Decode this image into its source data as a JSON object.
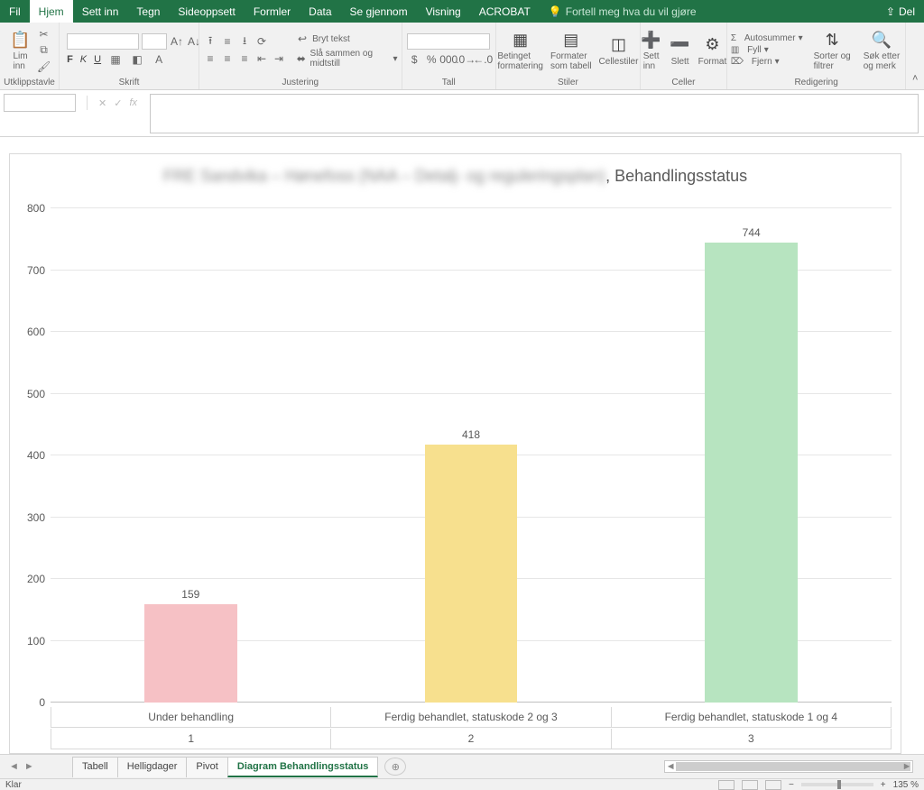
{
  "tabs": {
    "fil": "Fil",
    "hjem": "Hjem",
    "settinn": "Sett inn",
    "tegn": "Tegn",
    "sideoppsett": "Sideoppsett",
    "formler": "Formler",
    "data": "Data",
    "segjennom": "Se gjennom",
    "visning": "Visning",
    "acrobat": "ACROBAT"
  },
  "tellme": "Fortell meg hva du vil gjøre",
  "share": "Del",
  "ribbon": {
    "clipboard": {
      "paste": "Lim\ninn",
      "label": "Utklippstavle"
    },
    "font": {
      "label": "Skrift",
      "bold": "F",
      "italic": "K",
      "underline": "U"
    },
    "align": {
      "wrap": "Bryt tekst",
      "merge": "Slå sammen og midtstill",
      "label": "Justering"
    },
    "number": {
      "label": "Tall"
    },
    "styles": {
      "cond": "Betinget\nformatering",
      "fmt": "Formater\nsom tabell",
      "cell": "Cellestiler",
      "label": "Stiler"
    },
    "cells": {
      "ins": "Sett\ninn",
      "del": "Slett",
      "fmt": "Format",
      "label": "Celler"
    },
    "edit": {
      "sum": "Autosummer",
      "fill": "Fyll",
      "clear": "Fjern",
      "sort": "Sorter og\nfiltrer",
      "find": "Søk etter\nog merk",
      "label": "Redigering"
    }
  },
  "chart_data": {
    "type": "bar",
    "title_prefix_blurred": "FRE Sandvika – Hønefoss (NAA – Detalj- og reguleringsplan)",
    "title_suffix": ", Behandlingsstatus",
    "categories": [
      "Under behandling",
      "Ferdig behandlet, statuskode 2 og 3",
      "Ferdig behandlet, statuskode 1 og 4"
    ],
    "category_index": [
      "1",
      "2",
      "3"
    ],
    "values": [
      159,
      418,
      744
    ],
    "colors": [
      "#f6c1c5",
      "#f7e08e",
      "#b7e4c0"
    ],
    "ymax": 800,
    "ystep": 100,
    "yticks": [
      "0",
      "100",
      "200",
      "300",
      "400",
      "500",
      "600",
      "700",
      "800"
    ]
  },
  "sheet_tabs": [
    "Tabell",
    "Helligdager",
    "Pivot",
    "Diagram Behandlingsstatus"
  ],
  "active_sheet": 3,
  "status": {
    "ready": "Klar",
    "zoom": "135 %"
  }
}
